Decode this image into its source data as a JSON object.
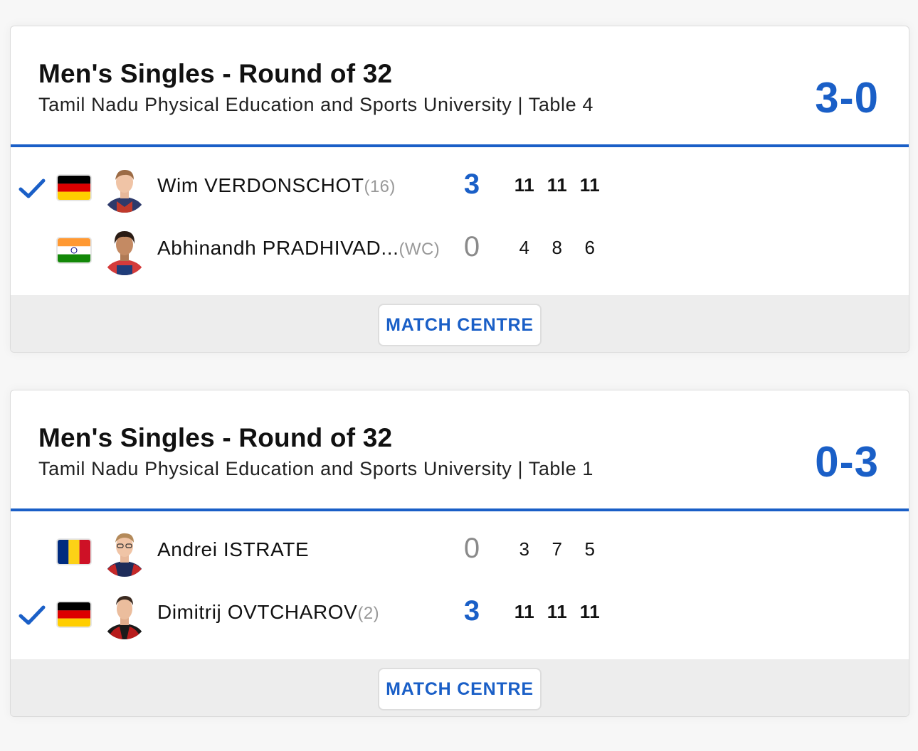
{
  "colors": {
    "accent": "#1a5fc7",
    "footer_bg": "#ededed",
    "loser_sets": "#8a8a8a",
    "seed": "#999999"
  },
  "matches": [
    {
      "title": "Men's Singles - Round of 32",
      "venue": "Tamil Nadu Physical Education and Sports University | Table 4",
      "score": "3-0",
      "players": [
        {
          "winner": true,
          "flag": "germany-flag-icon",
          "name": "Wim VERDONSCHOT",
          "seed": "(16)",
          "sets": "3",
          "games": [
            "11",
            "11",
            "11"
          ]
        },
        {
          "winner": false,
          "flag": "india-flag-icon",
          "name": "Abhinandh PRADHIVAD...",
          "seed": "(WC)",
          "sets": "0",
          "games": [
            "4",
            "8",
            "6"
          ]
        }
      ],
      "button_label": "MATCH CENTRE"
    },
    {
      "title": "Men's Singles - Round of 32",
      "venue": "Tamil Nadu Physical Education and Sports University | Table 1",
      "score": "0-3",
      "players": [
        {
          "winner": false,
          "flag": "romania-flag-icon",
          "name": "Andrei ISTRATE",
          "seed": "",
          "sets": "0",
          "games": [
            "3",
            "7",
            "5"
          ]
        },
        {
          "winner": true,
          "flag": "germany-flag-icon",
          "name": "Dimitrij OVTCHAROV",
          "seed": "(2)",
          "sets": "3",
          "games": [
            "11",
            "11",
            "11"
          ]
        }
      ],
      "button_label": "MATCH CENTRE"
    }
  ]
}
